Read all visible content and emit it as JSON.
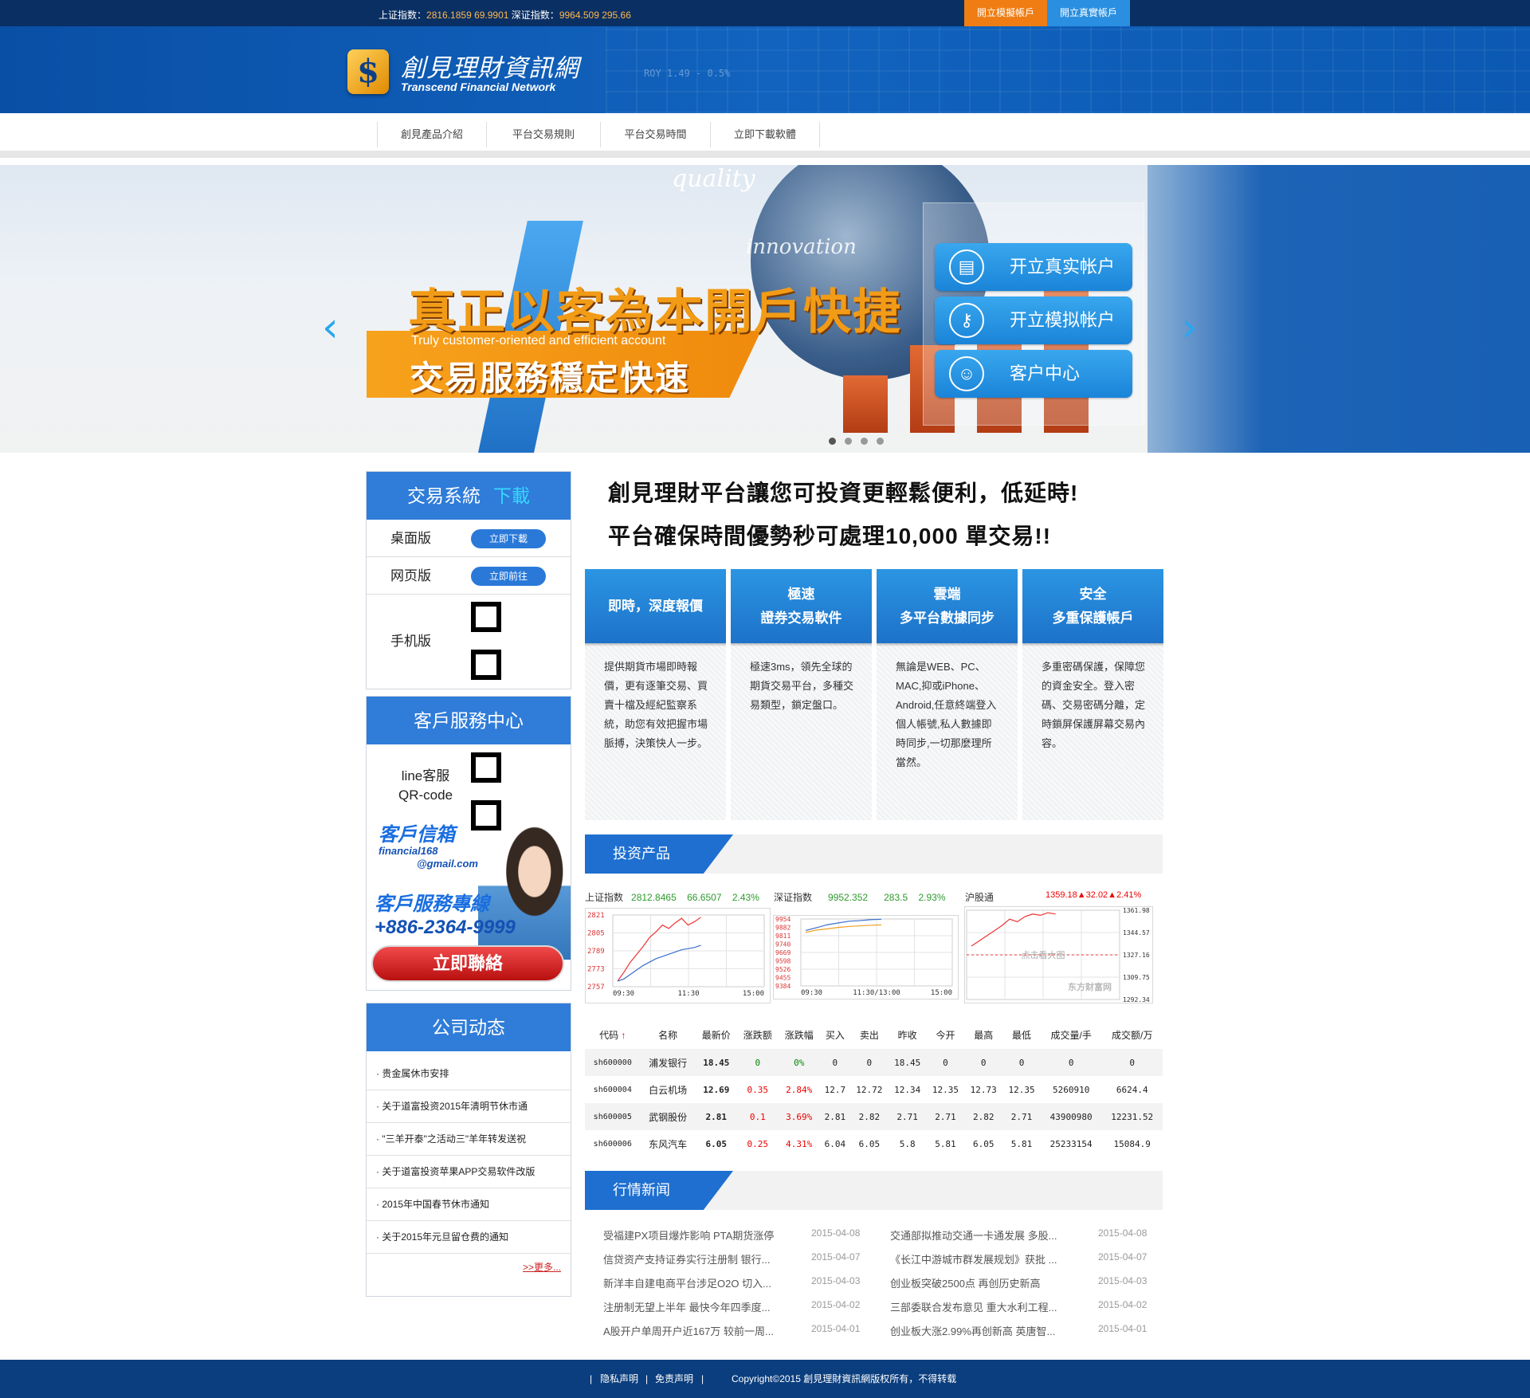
{
  "topbar": {
    "sh_label": "上证指数：",
    "sh_value": "2816.1859 69.9901",
    "sz_label": "深证指数：",
    "sz_value": "9964.509 295.66",
    "demo_btn": "開立模擬帳戶",
    "real_btn": "開立真實帳戶"
  },
  "header": {
    "logo_cn": "創見理財資訊網",
    "logo_en": "Transcend Financial Network",
    "ticker": "ROY 1.49 - 0.5%"
  },
  "nav": [
    "創見產品介紹",
    "平台交易規則",
    "平台交易時間",
    "立即下載軟體"
  ],
  "banner": {
    "word_quality": "quality",
    "word_innovation": "innovation",
    "slogan1": "真正以客為本開戶快捷",
    "slogan_en": "Truly customer-oriented and efficient account",
    "slogan2": "交易服務穩定快速",
    "buttons": [
      {
        "label": "开立真实帐户",
        "icon": "document-icon"
      },
      {
        "label": "开立模拟帐户",
        "icon": "key-icon"
      },
      {
        "label": "客户中心",
        "icon": "user-icon"
      }
    ],
    "prev": "‹",
    "next": "›"
  },
  "sidebar": {
    "download": {
      "title": "交易系統",
      "title_hl": "下載",
      "rows": [
        {
          "label": "桌面版",
          "btn": "立即下載"
        },
        {
          "label": "网页版",
          "btn": "立即前往"
        }
      ],
      "mobile_label": "手机版"
    },
    "service": {
      "title": "客戶服務中心",
      "line_label": "line客服",
      "qr_label": "QR-code",
      "mail_title": "客戶信箱",
      "mail_1": "financial168",
      "mail_2": "@gmail.com",
      "hotline_title": "客戶服務專線",
      "phone": "+886-2364-9999",
      "contact_btn": "立即聯絡"
    },
    "news": {
      "title": "公司动态",
      "items": [
        "· 贵金属休市安排",
        "· 关于道富投资2015年清明节休市通",
        "· \"三羊开泰\"之活动三\"羊年转发送祝",
        "· 关于道富投资苹果APP交易软件改版",
        "· 2015年中国春节休市通知",
        "· 关于2015年元旦留仓费的通知"
      ],
      "more": ">>更多..."
    }
  },
  "main": {
    "headline1": "創見理財平台讓您可投資更輕鬆便利，低延時!",
    "headline2": "平台確保時間優勢秒可處理10,000 單交易!!",
    "features": [
      {
        "h1": "即時，深度報價",
        "h2": "",
        "body": "提供期貨市場即時報價，更有逐筆交易、買賣十檔及經紀監察系統，助您有效把握市場脈搏，決策快人一步。"
      },
      {
        "h1": "極速",
        "h2": "證券交易軟件",
        "body": "極速3ms，領先全球的期貨交易平台，多種交易類型，鎖定盤口。"
      },
      {
        "h1": "雲端",
        "h2": "多平台數據同步",
        "body": "無論是WEB、PC、MAC,抑或iPhone、Android,任意終端登入個人帳號,私人數據即時同步,一切那麼理所當然。"
      },
      {
        "h1": "安全",
        "h2": "多重保護帳戶",
        "body": "多重密碼保護，保障您的資金安全。登入密碼、交易密碼分離，定時鎖屏保護屏幕交易內容。"
      }
    ],
    "invest_title": "投资产品",
    "market_title": "行情新闻",
    "idx": {
      "sh_name": "上证指数",
      "sh_val": "2812.8465",
      "sh_chg": "66.6507",
      "sh_pct": "2.43%",
      "sz_name": "深证指数",
      "sz_val": "9952.352",
      "sz_chg": "283.5",
      "sz_pct": "2.93%",
      "hs_name": "沪股通",
      "hs_val": "1359.18▲32.02▲2.41%"
    }
  },
  "chart_data": [
    {
      "type": "line",
      "title": "上证指数",
      "x_ticks": [
        "09:30",
        "11:30",
        "15:00"
      ],
      "y_ticks": [
        "2821",
        "2805",
        "2789",
        "2773",
        "2757"
      ],
      "ylim": [
        2757,
        2821
      ],
      "series": [
        {
          "values": [
            2762,
            2770,
            2779,
            2786,
            2793,
            2801,
            2806,
            2812,
            2809,
            2814,
            2818,
            2812,
            2815,
            2819
          ]
        },
        {
          "values": [
            2762,
            2764,
            2768,
            2772,
            2776,
            2779,
            2782,
            2784,
            2786,
            2788,
            2790,
            2791,
            2792,
            2794
          ]
        }
      ]
    },
    {
      "type": "line",
      "title": "深证指数",
      "x_ticks": [
        "09:30",
        "11:30/13:00",
        "15:00"
      ],
      "y_ticks": [
        "9954",
        "9882",
        "9811",
        "9740",
        "9669",
        "9598",
        "9526",
        "9455",
        "9384"
      ],
      "ylim": [
        9384,
        9954
      ],
      "series": [
        {
          "values": [
            9856,
            9880,
            9905,
            9920,
            9935,
            9940,
            9948,
            9952
          ]
        },
        {
          "values": [
            9840,
            9860,
            9870,
            9882,
            9890,
            9896,
            9900,
            9904
          ]
        }
      ]
    },
    {
      "type": "line",
      "title": "沪股通",
      "y_ticks": [
        "1361.98",
        "1344.57",
        "1327.16",
        "1309.75",
        "1292.34"
      ],
      "ylim": [
        1292.34,
        1361.98
      ],
      "note": "点击看大图",
      "source": "东方财富网",
      "series": [
        {
          "values": [
            1334,
            1338,
            1342,
            1346,
            1350,
            1355,
            1353,
            1357,
            1359,
            1358,
            1360,
            1359
          ]
        }
      ]
    }
  ],
  "quotes": {
    "headers": [
      "代码",
      "名称",
      "最新价",
      "涨跌额",
      "涨跌幅",
      "买入",
      "卖出",
      "昨收",
      "今开",
      "最高",
      "最低",
      "成交量/手",
      "成交额/万"
    ],
    "sort_icon": "↑",
    "rows": [
      [
        "sh600000",
        "浦发银行",
        "18.45",
        "0",
        "0%",
        "0",
        "0",
        "18.45",
        "0",
        "0",
        "0",
        "0",
        "0"
      ],
      [
        "sh600004",
        "白云机场",
        "12.69",
        "0.35",
        "2.84%",
        "12.7",
        "12.72",
        "12.34",
        "12.35",
        "12.73",
        "12.35",
        "5260910",
        "6624.4"
      ],
      [
        "sh600005",
        "武钢股份",
        "2.81",
        "0.1",
        "3.69%",
        "2.81",
        "2.82",
        "2.71",
        "2.71",
        "2.82",
        "2.71",
        "43900980",
        "12231.52"
      ],
      [
        "sh600006",
        "东风汽车",
        "6.05",
        "0.25",
        "4.31%",
        "6.04",
        "6.05",
        "5.8",
        "5.81",
        "6.05",
        "5.81",
        "25233154",
        "15084.9"
      ]
    ]
  },
  "market_news": [
    {
      "l": "受福建PX项目爆炸影响 PTA期货涨停",
      "ld": "2015-04-08",
      "r": "交通部拟推动交通一卡通发展 多股...",
      "rd": "2015-04-08"
    },
    {
      "l": "信贷资产支持证券实行注册制 银行...",
      "ld": "2015-04-07",
      "r": "《长江中游城市群发展规划》获批 ...",
      "rd": "2015-04-07"
    },
    {
      "l": "新洋丰自建电商平台涉足O2O 切入...",
      "ld": "2015-04-03",
      "r": "创业板突破2500点 再创历史新高",
      "rd": "2015-04-03"
    },
    {
      "l": "注册制无望上半年 最快今年四季度...",
      "ld": "2015-04-02",
      "r": "三部委联合发布意见 重大水利工程...",
      "rd": "2015-04-02"
    },
    {
      "l": "A股开户单周开户近167万 较前一周...",
      "ld": "2015-04-01",
      "r": "创业板大涨2.99%再创新高 英唐智...",
      "rd": "2015-04-01"
    }
  ],
  "footer": {
    "privacy": "隐私声明",
    "disclaimer": "免责声明",
    "sep": "|",
    "copyright": "Copyright©2015 創見理財資訊網版权所有，不得转载"
  },
  "colors": {
    "brand": "#0b4fa6",
    "accent": "#1e6fd0",
    "orange": "#ef7d14",
    "up": "#e00000"
  }
}
